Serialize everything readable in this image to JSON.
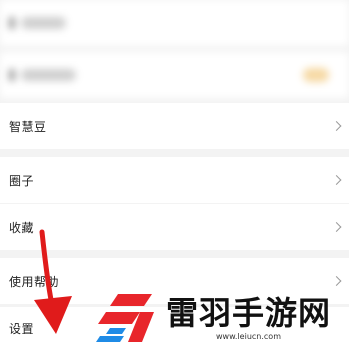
{
  "menu": {
    "items": [
      {
        "label": "智慧豆"
      },
      {
        "label": "圈子"
      },
      {
        "label": "收藏"
      },
      {
        "label": "使用帮助"
      },
      {
        "label": "设置"
      }
    ]
  },
  "watermark": {
    "title": "雷羽手游网",
    "url": "www.leiucn.com"
  },
  "colors": {
    "arrow": "#e01b1b",
    "logo_red": "#e8262b",
    "logo_blue": "#1f8be6"
  },
  "icons": [
    "chevron-right-icon",
    "arrow-down-icon",
    "logo-icon"
  ]
}
